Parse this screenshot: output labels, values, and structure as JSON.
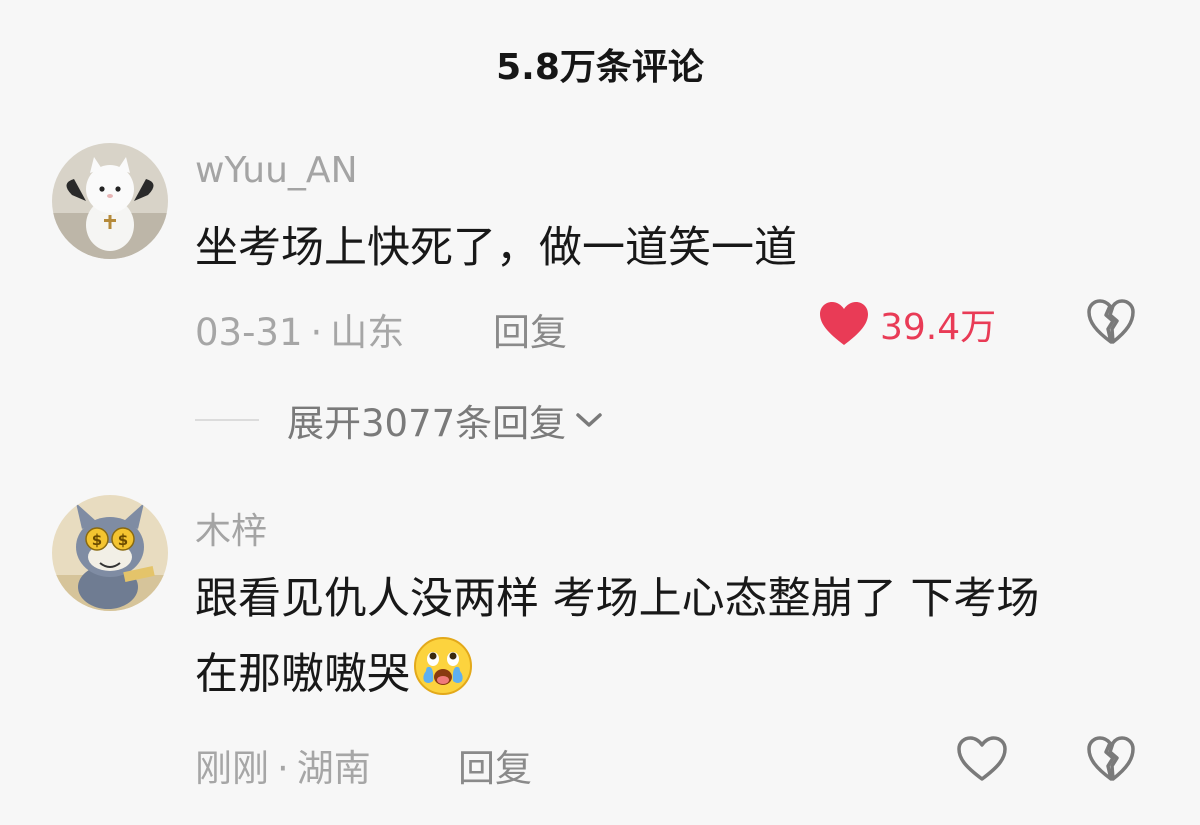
{
  "header": {
    "title": "5.8万条评论"
  },
  "comments": [
    {
      "username": "wYuu_AN",
      "text": "坐考场上快死了，做一道笑一道",
      "date": "03-31",
      "location": "山东",
      "separator": "·",
      "reply_label": "回复",
      "likes": "39.4万",
      "liked": true,
      "avatar_icon": "white-cat-plush-avatar",
      "expand_label": "展开3077条回复"
    },
    {
      "username": "木梓",
      "text_line1": "跟看见仇人没两样 考场上心态整崩了 下考场",
      "text_line2": "在那嗷嗷哭",
      "emoji_icon": "crying-laughing-emoji",
      "date": "刚刚",
      "location": "湖南",
      "separator": "·",
      "reply_label": "回复",
      "liked": false,
      "avatar_icon": "tom-cat-money-eyes-avatar"
    }
  ],
  "colors": {
    "like_red": "#e93b56",
    "muted_text": "#a6a6a6",
    "background": "#f7f7f7"
  }
}
